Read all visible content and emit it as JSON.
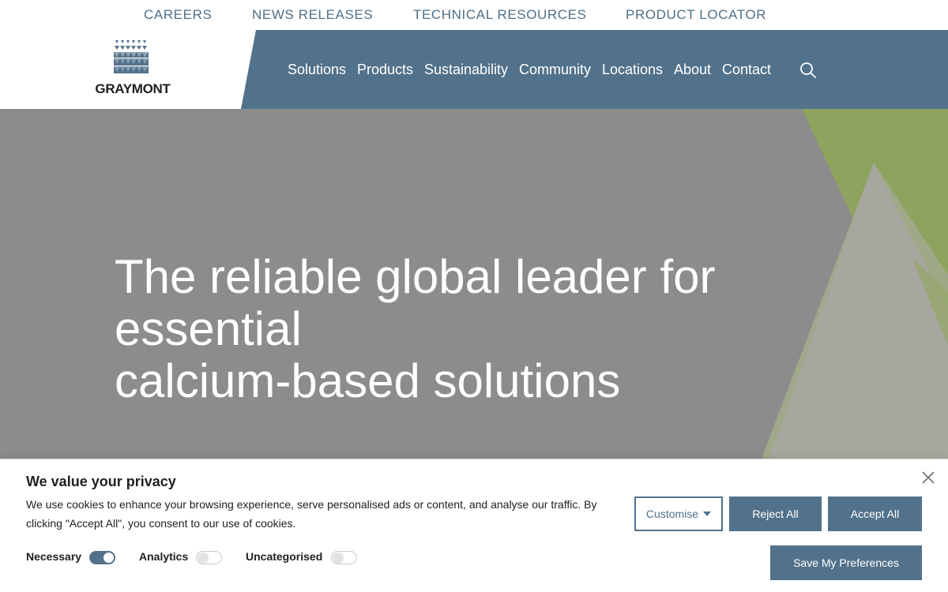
{
  "utility_nav": [
    "CAREERS",
    "NEWS RELEASES",
    "TECHNICAL RESOURCES",
    "PRODUCT LOCATOR"
  ],
  "logo": {
    "text": "GRAYMONT"
  },
  "main_nav": [
    "Solutions",
    "Products",
    "Sustainability",
    "Community",
    "Locations",
    "About",
    "Contact"
  ],
  "icons": {
    "search": "search-icon",
    "close": "close-icon",
    "dropdown": "caret-down-icon"
  },
  "hero": {
    "title_lines": [
      "The reliable global leader for",
      "essential",
      "calcium-based solutions"
    ]
  },
  "cookie_banner": {
    "title": "We value your privacy",
    "text": "We use cookies to enhance your browsing experience, serve personalised ads or content, and analyse our traffic. By clicking \"Accept All\", you consent to our use of cookies.",
    "categories": [
      {
        "label": "Necessary",
        "enabled": true
      },
      {
        "label": "Analytics",
        "enabled": false
      },
      {
        "label": "Uncategorised",
        "enabled": false
      }
    ],
    "buttons": {
      "customise": "Customise",
      "reject_all": "Reject All",
      "accept_all": "Accept All",
      "save_preferences": "Save My Preferences"
    }
  },
  "colors": {
    "brand_blue": "#52728b",
    "hero_gray": "#8c8c8c",
    "accent_green": "#8ea35e",
    "text_dark": "#212121"
  }
}
